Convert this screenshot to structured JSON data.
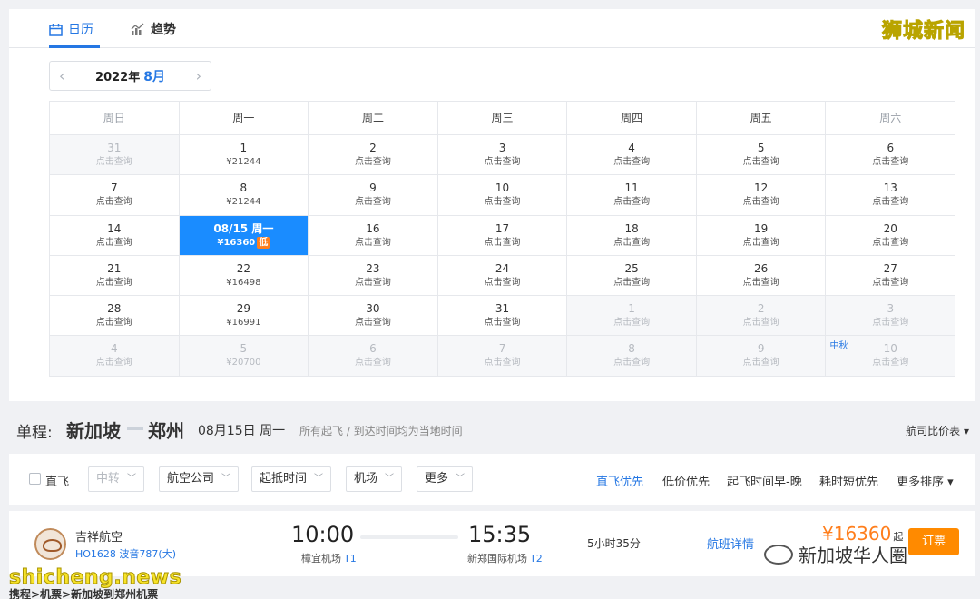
{
  "tabs": {
    "calendar": "日历",
    "trend": "趋势"
  },
  "watermark_top": "狮城新闻",
  "month_nav": {
    "year": "2022年",
    "month": "8月",
    "prev": "‹",
    "next": "›"
  },
  "weekdays": [
    "周日",
    "周一",
    "周二",
    "周三",
    "周四",
    "周五",
    "周六"
  ],
  "calendar": [
    [
      {
        "d": "31",
        "p": "点击查询",
        "muted": true
      },
      {
        "d": "1",
        "p": "¥21244"
      },
      {
        "d": "2",
        "p": "点击查询"
      },
      {
        "d": "3",
        "p": "点击查询"
      },
      {
        "d": "4",
        "p": "点击查询"
      },
      {
        "d": "5",
        "p": "点击查询"
      },
      {
        "d": "6",
        "p": "点击查询"
      }
    ],
    [
      {
        "d": "7",
        "p": "点击查询"
      },
      {
        "d": "8",
        "p": "¥21244"
      },
      {
        "d": "9",
        "p": "点击查询"
      },
      {
        "d": "10",
        "p": "点击查询"
      },
      {
        "d": "11",
        "p": "点击查询"
      },
      {
        "d": "12",
        "p": "点击查询"
      },
      {
        "d": "13",
        "p": "点击查询"
      }
    ],
    [
      {
        "d": "14",
        "p": "点击查询"
      },
      {
        "d": "08/15 周一",
        "p": "¥16360",
        "selected": true,
        "badge": "低"
      },
      {
        "d": "16",
        "p": "点击查询"
      },
      {
        "d": "17",
        "p": "点击查询"
      },
      {
        "d": "18",
        "p": "点击查询"
      },
      {
        "d": "19",
        "p": "点击查询"
      },
      {
        "d": "20",
        "p": "点击查询"
      }
    ],
    [
      {
        "d": "21",
        "p": "点击查询"
      },
      {
        "d": "22",
        "p": "¥16498"
      },
      {
        "d": "23",
        "p": "点击查询"
      },
      {
        "d": "24",
        "p": "点击查询"
      },
      {
        "d": "25",
        "p": "点击查询"
      },
      {
        "d": "26",
        "p": "点击查询"
      },
      {
        "d": "27",
        "p": "点击查询"
      }
    ],
    [
      {
        "d": "28",
        "p": "点击查询"
      },
      {
        "d": "29",
        "p": "¥16991"
      },
      {
        "d": "30",
        "p": "点击查询"
      },
      {
        "d": "31",
        "p": "点击查询"
      },
      {
        "d": "1",
        "p": "点击查询",
        "muted": true
      },
      {
        "d": "2",
        "p": "点击查询",
        "muted": true
      },
      {
        "d": "3",
        "p": "点击查询",
        "muted": true
      }
    ],
    [
      {
        "d": "4",
        "p": "点击查询",
        "muted": true
      },
      {
        "d": "5",
        "p": "¥20700",
        "muted": true
      },
      {
        "d": "6",
        "p": "点击查询",
        "muted": true
      },
      {
        "d": "7",
        "p": "点击查询",
        "muted": true
      },
      {
        "d": "8",
        "p": "点击查询",
        "muted": true
      },
      {
        "d": "9",
        "p": "点击查询",
        "muted": true
      },
      {
        "d": "10",
        "p": "点击查询",
        "muted": true,
        "holiday": "中秋"
      }
    ]
  ],
  "route": {
    "kind": "单程:",
    "from": "新加坡",
    "to": "郑州",
    "date": "08月15日 周一",
    "note": "所有起飞 / 到达时间均为当地时间",
    "compare": "航司比价表 ▾"
  },
  "filter": {
    "direct": "直飞",
    "dropdowns": [
      "中转",
      "航空公司",
      "起抵时间",
      "机场",
      "更多"
    ],
    "sorts": [
      "直飞优先",
      "低价优先",
      "起飞时间早-晚",
      "耗时短优先",
      "更多排序 ▾"
    ]
  },
  "flight": {
    "airline": "吉祥航空",
    "number": "HO1628 波音787(大)",
    "dep_time": "10:00",
    "dep_airport": "樟宜机场",
    "dep_terminal": "T1",
    "arr_time": "15:35",
    "arr_airport": "新郑国际机场",
    "arr_terminal": "T2",
    "duration": "5小时35分",
    "details": "航班详情",
    "price": "¥16360",
    "price_suffix": "起",
    "book": "订票"
  },
  "wechat_watermark": "新加坡华人圈",
  "watermark_bottom": "shicheng.news",
  "breadcrumb": "携程>机票>新加坡到郑州机票",
  "colors": {
    "accent": "#2577e3",
    "selected": "#1a8cff",
    "price": "#ff7e1c"
  }
}
